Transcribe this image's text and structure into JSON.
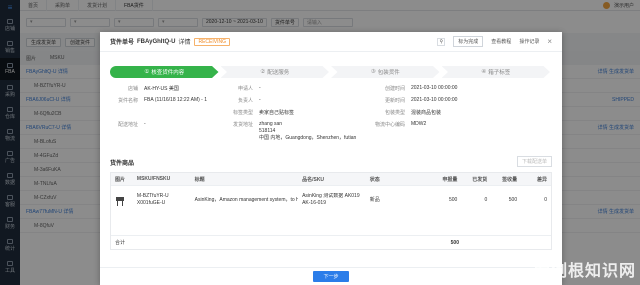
{
  "sidebar": {
    "items": [
      {
        "label": "店铺"
      },
      {
        "label": "销售"
      },
      {
        "label": "FBA"
      },
      {
        "label": "采购"
      },
      {
        "label": "仓库"
      },
      {
        "label": "物流"
      },
      {
        "label": "广告"
      },
      {
        "label": "数据"
      },
      {
        "label": "客服"
      },
      {
        "label": "财务"
      },
      {
        "label": "统计"
      },
      {
        "label": "工具"
      }
    ]
  },
  "topbar": {
    "tabs": [
      "首页",
      "采购单",
      "发货计划",
      "FBA货件"
    ],
    "user": "演示用户"
  },
  "filters": {
    "start_date": "2020-12-10",
    "end_date": "2021-03-10",
    "field": "货件单号",
    "search_placeholder": "请输入"
  },
  "actions": {
    "create": "生成发货单",
    "create2": "创建货件"
  },
  "background": {
    "head": [
      "图片",
      "MSKU"
    ],
    "rows": [
      {
        "text": "FBAyGhltQ-U 详情",
        "link": true,
        "right": "详情  生成发货单"
      },
      {
        "text": "M-BZTfuYR-U",
        "link": false,
        "right": ""
      },
      {
        "text": "FBA6J06uCl-U 详情",
        "link": true,
        "right": "SHIPPED"
      },
      {
        "text": "M-6Qflu2CB",
        "link": false,
        "right": ""
      },
      {
        "text": "FBA6VRuC7-U 详情",
        "link": true,
        "right": "详情  生成发货单"
      },
      {
        "text": "M-BLofuS",
        "link": false,
        "right": ""
      },
      {
        "text": "M-4GFuZd",
        "link": false,
        "right": ""
      },
      {
        "text": "M-3a6FuKA",
        "link": false,
        "right": ""
      },
      {
        "text": "M-TNLfuA",
        "link": false,
        "right": ""
      },
      {
        "text": "M-CZxfuV",
        "link": false,
        "right": ""
      },
      {
        "text": "FBAw77fuMN-U 详情",
        "link": true,
        "right": "详情  生成发货单"
      },
      {
        "text": "M-8QfuV",
        "link": false,
        "right": ""
      }
    ]
  },
  "modal": {
    "title_label": "货件单号",
    "shipment_id": "FBAyGhltQ-U",
    "detail": "详情",
    "status": "RECEIVING",
    "header_actions": [
      "标为完成",
      "查看教程",
      "操作记录"
    ],
    "steps": [
      {
        "num": "①",
        "label": "核查货件内容"
      },
      {
        "num": "②",
        "label": "配送服务"
      },
      {
        "num": "③",
        "label": "包装货件"
      },
      {
        "num": "④",
        "label": "箱子标签"
      }
    ],
    "info_rows": [
      [
        {
          "label": "店铺",
          "value": "AK-HY-US 美国"
        },
        {
          "label": "申请人",
          "value": "-"
        },
        {
          "label": "创建时间",
          "value": "2021-03-10 00:00:00"
        }
      ],
      [
        {
          "label": "货件名称",
          "value": "FBA (11/16/18 12:22 AM) - 1"
        },
        {
          "label": "负责人",
          "value": "-"
        },
        {
          "label": "更新时间",
          "value": "2021-03-10 00:00:00"
        }
      ],
      [
        {
          "label": "",
          "value": ""
        },
        {
          "label": "标签类型",
          "value": "卖家自己贴标签"
        },
        {
          "label": "包装类型",
          "value": "混装商品包装"
        }
      ],
      [
        {
          "label": "配送地址",
          "value": "-"
        },
        {
          "label": "发货地址",
          "value": "zhang san"
        },
        {
          "label": "物流中心编码",
          "value": "MDW2"
        }
      ]
    ],
    "ship_address": {
      "line2": "518114",
      "line3": "中国 内地，Guangdong，Shenzhen，futian"
    },
    "goods_title": "货件商品",
    "goods_button": "下载配送单",
    "columns": [
      "图片",
      "MSKU/FNSKU",
      "标题",
      "品名/SKU",
      "状态",
      "申报量",
      "已发货",
      "签收量",
      "差异"
    ],
    "goods": [
      {
        "msku": "M-BZTfuYR-U",
        "fnsku": "X001fuGE-U",
        "title": "AsinKing，Amazon management system，to he",
        "name": "AsinKing 测试数据 AK019",
        "sku": "AK-16-019",
        "status": "新品",
        "declared": "500",
        "shipped": "0",
        "received": "500",
        "diff": "0"
      }
    ],
    "total_label": "合计",
    "total_declared": "500",
    "next_button": "下一步"
  },
  "watermark": "爱例根知识网"
}
